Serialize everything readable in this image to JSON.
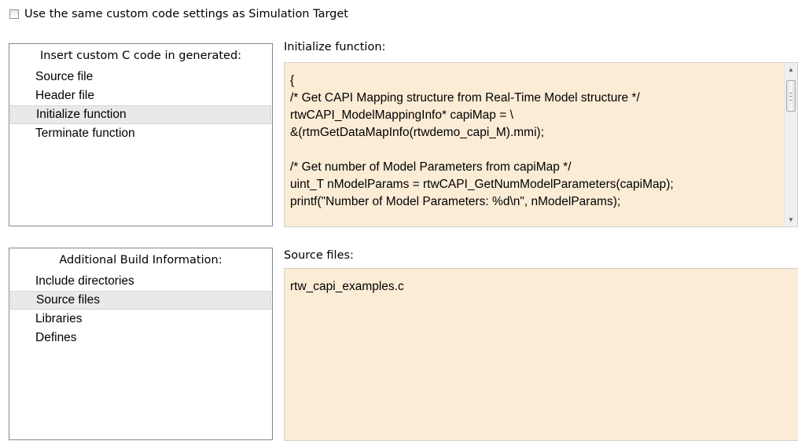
{
  "checkbox": {
    "label": "Use the same custom code settings as Simulation Target",
    "checked": false
  },
  "custom_code_panel": {
    "header": "Insert custom C code in generated:",
    "items": [
      "Source file",
      "Header file",
      "Initialize function",
      "Terminate function"
    ],
    "selected": "Initialize function"
  },
  "initialize_editor": {
    "label": "Initialize function:",
    "lines": [
      "{",
      "/* Get CAPI Mapping structure from Real-Time Model structure */",
      "rtwCAPI_ModelMappingInfo* capiMap = \\",
      "&(rtmGetDataMapInfo(rtwdemo_capi_M).mmi);",
      "",
      "/* Get number of Model Parameters from capiMap */",
      "uint_T nModelParams = rtwCAPI_GetNumModelParameters(capiMap);",
      "printf(\"Number of Model Parameters: %d\\n\", nModelParams);"
    ]
  },
  "build_info_panel": {
    "header": "Additional Build Information:",
    "items": [
      "Include directories",
      "Source files",
      "Libraries",
      "Defines"
    ],
    "selected": "Source files"
  },
  "source_files_editor": {
    "label": "Source files:",
    "lines": [
      "rtw_capi_examples.c"
    ]
  },
  "colors": {
    "editor_background": "#fbecd6",
    "selection_background": "#e9e9e9",
    "panel_border": "#828790"
  }
}
